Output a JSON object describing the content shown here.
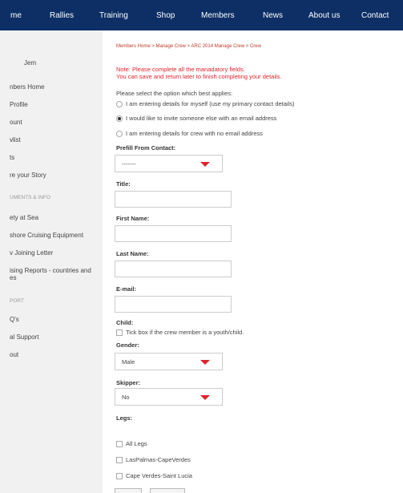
{
  "nav": {
    "items": [
      "me",
      "Rallies",
      "Training",
      "Shop",
      "Members",
      "News",
      "About us",
      "Contact"
    ]
  },
  "sidebar": {
    "user_name": "Jem",
    "items": [
      "nbers Home",
      "Profile",
      "ount",
      "vlist",
      "ts",
      "re your Story"
    ],
    "section_documents": "UMENTS & INFO",
    "doc_items": [
      "ety at Sea",
      "shore Cruising Equipment",
      "v Joining Letter",
      "ising Reports - countries and\nes"
    ],
    "section_support": "PORT",
    "support_items": [
      "Q's",
      "al Support",
      "out"
    ]
  },
  "breadcrumb": "Members Home > Manage Crew > ARC 2014 Manage Crew > Crew",
  "note": {
    "line1": "Note: Please complete all the manadatory fields.",
    "line2": "You can save and return later to finish completing your details."
  },
  "options": {
    "prompt": "Please select the option which best applies:",
    "items": [
      "I am entering details for myself (use my primary contact details)",
      "I would like to invite someone else with an email address",
      "I am entering details for crew with no email address"
    ],
    "selected_index": 1
  },
  "form": {
    "prefill_label": "Prefill From Contact:",
    "prefill_value": "-------",
    "title_label": "Title:",
    "first_name_label": "First Name:",
    "last_name_label": "Last Name:",
    "email_label": "E-mail:",
    "child_label": "Child:",
    "child_checkbox_text": "Tick box if the crew member is a youth/child.",
    "gender_label": "Gender:",
    "gender_value": "Male",
    "skipper_label": "Skipper:",
    "skipper_value": "No",
    "legs_label": "Legs:",
    "legs": [
      "All Legs",
      "LasPalmas-CapeVerdes",
      "Cape Verdes-Saint Lucia"
    ]
  },
  "colors": {
    "nav_bg": "#0d2f66",
    "accent_red": "#e0242c",
    "sidebar_bg": "#f1f1f1"
  }
}
